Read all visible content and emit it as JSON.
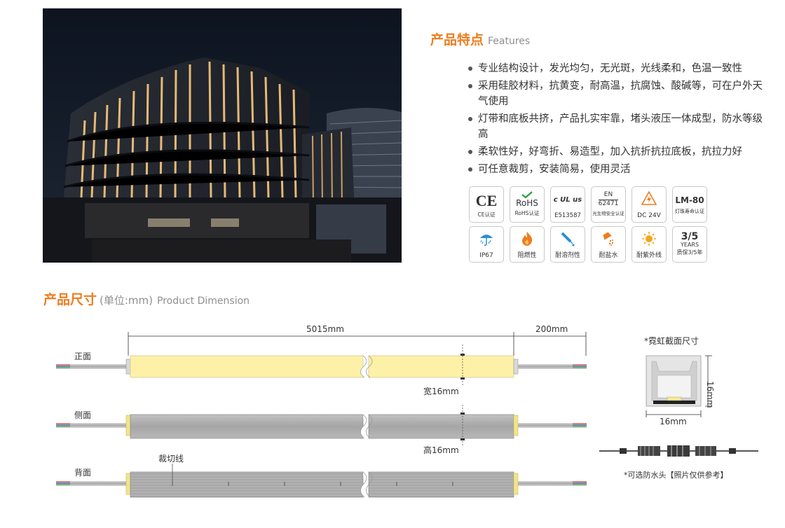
{
  "features": {
    "title": "产品特点",
    "title_en": "Features",
    "items": [
      "专业结构设计，发光均匀，无光斑，光线柔和，色温一致性",
      "采用硅胶材料，抗黄变，耐高温，抗腐蚀、酸碱等，可在户外天气使用",
      "灯带和底板共挤，产品扎实牢靠，堵头液压一体成型，防水等级高",
      "柔软性好，好弯折、易造型，加入抗折抗拉底板，抗拉力好",
      "可任意裁剪，安装简易，使用灵活"
    ]
  },
  "badges": {
    "ce": {
      "mark": "CE",
      "caption": "CE认证"
    },
    "rohs": {
      "mark": "RoHS",
      "caption": "RoHS认证"
    },
    "ul": {
      "mark": "c UL us",
      "caption": "E513587"
    },
    "en": {
      "mark": "EN",
      "number": "62471",
      "caption": "光生物安全认证"
    },
    "dc": {
      "caption": "DC 24V"
    },
    "lm": {
      "mark": "LM-80",
      "caption": "灯珠寿命认证"
    },
    "ip": {
      "caption": "IP67"
    },
    "flame": {
      "caption": "阻燃性"
    },
    "solvent": {
      "caption": "耐溶剂性"
    },
    "salt": {
      "caption": "耐盐水"
    },
    "uv": {
      "caption": "耐紫外线"
    },
    "warranty": {
      "mark": "3/5",
      "unit": "YEARS",
      "caption": "质保3/5年"
    }
  },
  "dimension": {
    "title": "产品尺寸",
    "unit": "(单位:mm)",
    "title_en": "Product Dimension",
    "length_label": "5015mm",
    "lead_label": "200mm",
    "front_label": "正面",
    "side_label": "侧面",
    "back_label": "背面",
    "width_label": "宽16mm",
    "height_label": "高16mm",
    "cut_label": "裁切线",
    "section_title": "*霓虹截面尺寸",
    "section_width": "16mm",
    "section_height": "16mm",
    "connector_note": "*可选防水头【照片仅供参考】"
  },
  "colors": {
    "accent": "#ee7d1f",
    "strip_light": "#fdf1a8",
    "strip_gray": "#a9a9a9"
  }
}
